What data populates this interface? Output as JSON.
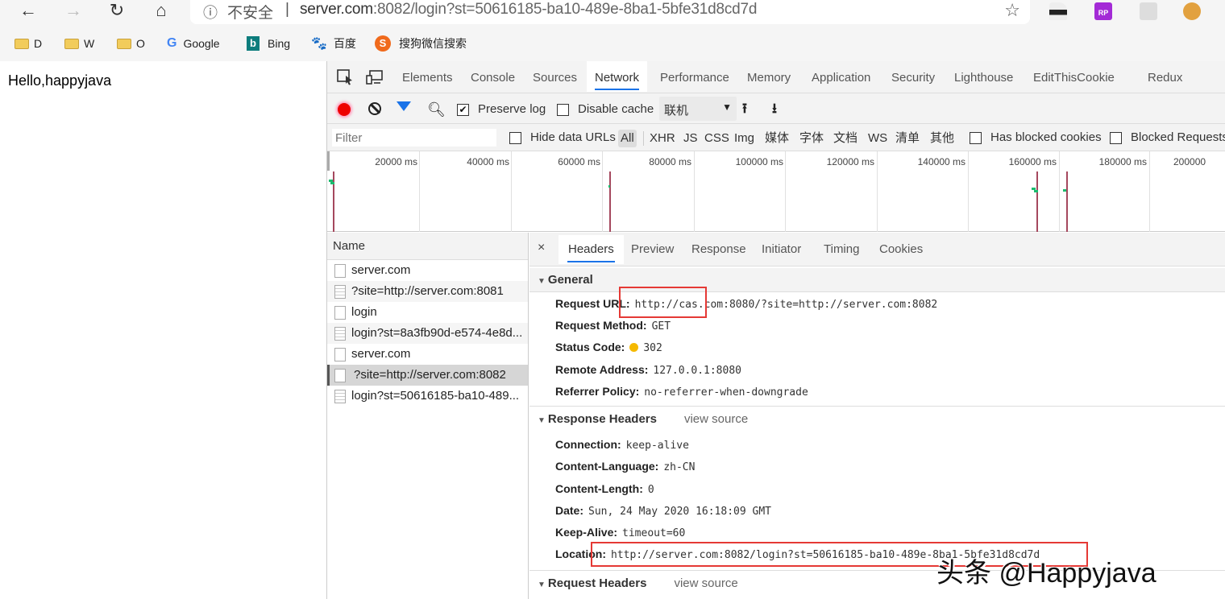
{
  "browser": {
    "nav": {
      "back": "←",
      "forward": "→",
      "reload": "↻",
      "home": "⌂"
    },
    "omnibox": {
      "security_icon": "info-circle-icon",
      "security_label": "不安全",
      "url_host": "server.com",
      "url_rest": ":8082/login?st=50616185-ba10-489e-8ba1-5bfe31d8cd7d",
      "bookmark_icon": "star-plus-icon"
    },
    "extensions": [
      "incognito-mask-extension",
      "axure-rp-extension",
      "react-devtools-extension",
      "cookie-extension"
    ],
    "extension_rp_label": "RP",
    "bookmarks": [
      {
        "label": "D",
        "icon": "folder-icon"
      },
      {
        "label": "W",
        "icon": "folder-icon"
      },
      {
        "label": "O",
        "icon": "folder-icon"
      },
      {
        "label": "Google",
        "icon": "google-icon"
      },
      {
        "label": "Bing",
        "icon": "bing-icon"
      },
      {
        "label": "百度",
        "icon": "baidu-icon"
      },
      {
        "label": "搜狗微信搜索",
        "icon": "sogou-icon"
      }
    ]
  },
  "page": {
    "text": "Hello,happyjava"
  },
  "devtools": {
    "tabs": [
      "Elements",
      "Console",
      "Sources",
      "Network",
      "Performance",
      "Memory",
      "Application",
      "Security",
      "Lighthouse",
      "EditThisCookie",
      "Redux"
    ],
    "active_tab": "Network",
    "toolbar": {
      "preserve_log": {
        "label": "Preserve log",
        "checked": true
      },
      "disable_cache": {
        "label": "Disable cache",
        "checked": false
      },
      "throttling": "联机"
    },
    "filter": {
      "placeholder": "Filter",
      "hide_data_urls": {
        "label": "Hide data URLs",
        "checked": false
      },
      "types": [
        "All",
        "XHR",
        "JS",
        "CSS",
        "Img",
        "媒体",
        "字体",
        "文档",
        "WS",
        "清单",
        "其他"
      ],
      "active_type": "All",
      "has_blocked_cookies": {
        "label": "Has blocked cookies",
        "checked": false
      },
      "blocked_requests": {
        "label": "Blocked Requests",
        "checked": false
      }
    },
    "overview": {
      "ticks": [
        "20000 ms",
        "40000 ms",
        "60000 ms",
        "80000 ms",
        "100000 ms",
        "120000 ms",
        "140000 ms",
        "160000 ms",
        "180000 ms",
        "200000"
      ]
    },
    "requests": {
      "header": "Name",
      "rows": [
        {
          "name": "server.com",
          "type": "blank",
          "selected": false
        },
        {
          "name": "?site=http://server.com:8081",
          "type": "doc",
          "selected": false
        },
        {
          "name": "login",
          "type": "blank",
          "selected": false
        },
        {
          "name": "login?st=8a3fb90d-e574-4e8d...",
          "type": "doc",
          "selected": false
        },
        {
          "name": "server.com",
          "type": "blank",
          "selected": false
        },
        {
          "name": "?site=http://server.com:8082",
          "type": "blank",
          "selected": true
        },
        {
          "name": "login?st=50616185-ba10-489...",
          "type": "doc",
          "selected": false
        }
      ]
    },
    "detail": {
      "close": "×",
      "tabs": [
        "Headers",
        "Preview",
        "Response",
        "Initiator",
        "Timing",
        "Cookies"
      ],
      "active_tab": "Headers",
      "general": {
        "title": "General",
        "rows": [
          {
            "key": "Request URL:",
            "value": "http://cas.com:8080/?site=http://server.com:8082"
          },
          {
            "key": "Request Method:",
            "value": "GET"
          },
          {
            "key": "Status Code:",
            "value": "302",
            "status_color": "#f5b900"
          },
          {
            "key": "Remote Address:",
            "value": "127.0.0.1:8080"
          },
          {
            "key": "Referrer Policy:",
            "value": "no-referrer-when-downgrade"
          }
        ]
      },
      "response_headers": {
        "title": "Response Headers",
        "view_source": "view source",
        "rows": [
          {
            "key": "Connection:",
            "value": "keep-alive"
          },
          {
            "key": "Content-Language:",
            "value": "zh-CN"
          },
          {
            "key": "Content-Length:",
            "value": "0"
          },
          {
            "key": "Date:",
            "value": "Sun, 24 May 2020 16:18:09 GMT"
          },
          {
            "key": "Keep-Alive:",
            "value": "timeout=60"
          },
          {
            "key": "Location:",
            "value": "http://server.com:8082/login?st=50616185-ba10-489e-8ba1-5bfe31d8cd7d"
          }
        ]
      },
      "request_headers": {
        "title": "Request Headers",
        "view_source": "view source"
      }
    }
  },
  "annotations": {
    "highlight_color": "#e53935"
  },
  "watermark": "头条 @Happyjava"
}
